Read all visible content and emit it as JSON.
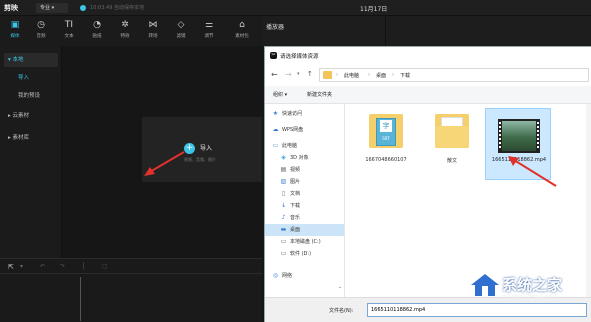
{
  "app": {
    "brand": "剪映",
    "mode": "专业",
    "autosave": "10:03:49 自动保存本地",
    "date": "11月17日"
  },
  "toolbar": {
    "items": [
      {
        "label": "媒体",
        "icon": "media-icon",
        "glyph": "▣",
        "active": true
      },
      {
        "label": "音频",
        "icon": "audio-icon",
        "glyph": "◷"
      },
      {
        "label": "文本",
        "icon": "text-icon",
        "glyph": "TI"
      },
      {
        "label": "贴纸",
        "icon": "sticker-icon",
        "glyph": "◔"
      },
      {
        "label": "特效",
        "icon": "effects-icon",
        "glyph": "✲"
      },
      {
        "label": "转场",
        "icon": "transition-icon",
        "glyph": "⋈"
      },
      {
        "label": "滤镜",
        "icon": "filter-icon",
        "glyph": "◇"
      },
      {
        "label": "调节",
        "icon": "adjust-icon",
        "glyph": "⚌"
      },
      {
        "label": "素材包",
        "icon": "package-icon",
        "glyph": "⌂"
      }
    ]
  },
  "sidebar": {
    "items": [
      {
        "label": "▾ 本地",
        "active": true
      },
      {
        "label": "导入",
        "accent": true
      },
      {
        "label": "我的预设"
      },
      {
        "label": "▸ 云素材"
      },
      {
        "label": "▸ 素材库"
      }
    ]
  },
  "import": {
    "label": "导入",
    "hint": "视频、音频、图片"
  },
  "player": {
    "title": "播放器"
  },
  "dialog": {
    "title": "请选择媒体资源",
    "path": [
      "此电脑",
      "桌面",
      "下载"
    ],
    "organize": "组织 ▾",
    "new_folder": "新建文件夹",
    "nav": [
      {
        "label": "快速访问",
        "glyph": "★",
        "color": "#3b7ddd"
      },
      {
        "label": "WPS网盘",
        "glyph": "☁",
        "color": "#3b7ddd"
      },
      {
        "label": "此电脑",
        "glyph": "▭",
        "color": "#4a90d9"
      },
      {
        "label": "3D 对象",
        "glyph": "◈",
        "color": "#3aa0e0"
      },
      {
        "label": "视频",
        "glyph": "▤",
        "color": "#555"
      },
      {
        "label": "图片",
        "glyph": "▨",
        "color": "#4a8ad0"
      },
      {
        "label": "文档",
        "glyph": "▯",
        "color": "#777"
      },
      {
        "label": "下载",
        "glyph": "↓",
        "color": "#2a6fd6"
      },
      {
        "label": "音乐",
        "glyph": "♪",
        "color": "#2a6fd6"
      },
      {
        "label": "桌面",
        "glyph": "▬",
        "color": "#3a7bd5",
        "selected": true
      },
      {
        "label": "本地磁盘 (C:)",
        "glyph": "▭",
        "color": "#666"
      },
      {
        "label": "软件 (D:)",
        "glyph": "▭",
        "color": "#666"
      },
      {
        "label": "网络",
        "glyph": "◎",
        "color": "#3b7ddd"
      }
    ],
    "files": [
      {
        "name": "1667048660107",
        "kind": "srt",
        "badge": "字",
        "ext": "SRT"
      },
      {
        "name": "散文",
        "kind": "folder"
      },
      {
        "name": "1665110118862.mp4",
        "kind": "video",
        "selected": true
      }
    ],
    "filename_label": "文件名(N):",
    "filename_value": "1665110118862.mp4"
  },
  "watermark": {
    "text": "系统之家",
    "url": "XITONGZHIJIA.NET"
  }
}
